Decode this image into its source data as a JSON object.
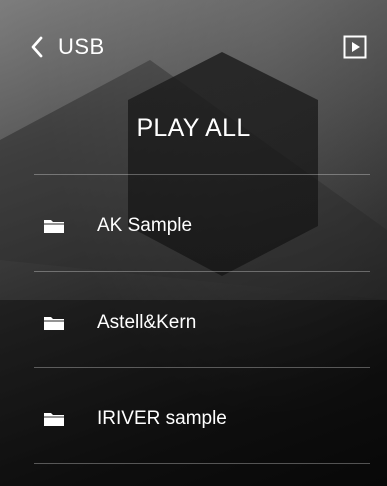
{
  "header": {
    "title": "USB",
    "back_icon": "chevron-left-icon",
    "play_icon": "play-box-icon"
  },
  "play_all_label": "PLAY ALL",
  "folders": [
    {
      "label": "AK Sample",
      "icon": "folder-icon"
    },
    {
      "label": "Astell&Kern",
      "icon": "folder-icon"
    },
    {
      "label": "IRIVER sample",
      "icon": "folder-icon"
    }
  ],
  "colors": {
    "text": "#ffffff",
    "divider": "#ffffff4d"
  }
}
